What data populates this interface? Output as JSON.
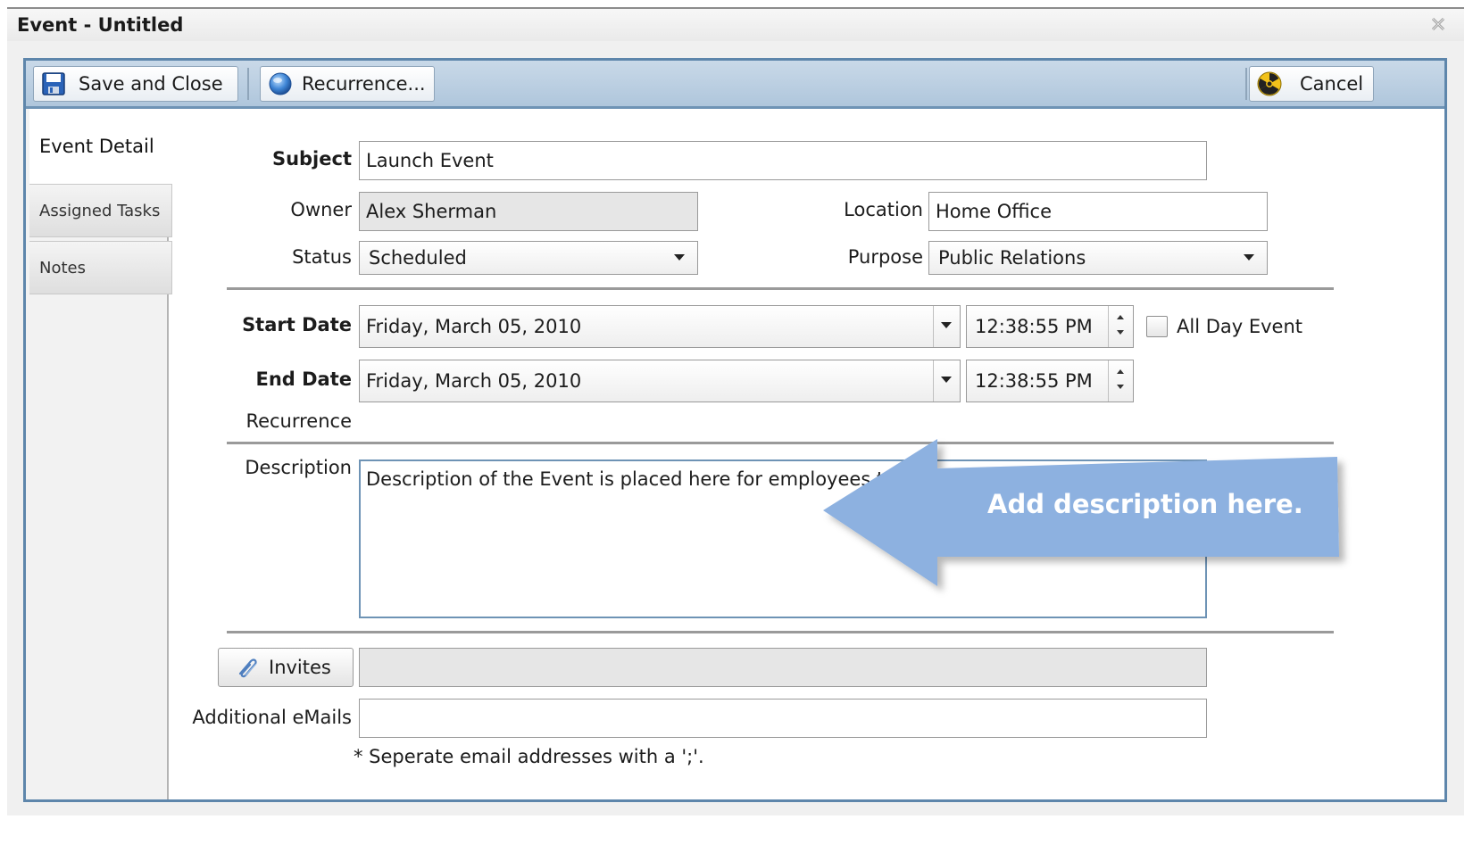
{
  "window": {
    "title": "Event - Untitled"
  },
  "toolbar": {
    "save_label": "Save and Close",
    "recurrence_label": "Recurrence...",
    "cancel_label": "Cancel"
  },
  "sidebar": {
    "tabs": [
      {
        "label": "Event Detail",
        "active": true
      },
      {
        "label": "Assigned Tasks",
        "active": false
      },
      {
        "label": "Notes",
        "active": false
      }
    ]
  },
  "form": {
    "subject_label": "Subject",
    "subject_value": "Launch Event",
    "owner_label": "Owner",
    "owner_value": "Alex Sherman",
    "location_label": "Location",
    "location_value": "Home Office",
    "status_label": "Status",
    "status_value": "Scheduled",
    "purpose_label": "Purpose",
    "purpose_value": "Public Relations",
    "start_date_label": "Start Date",
    "start_date_value": "Friday, March 05, 2010",
    "start_time_value": "12:38:55 PM",
    "all_day_label": "All Day Event",
    "all_day_checked": false,
    "end_date_label": "End Date",
    "end_date_value": "Friday, March 05, 2010",
    "end_time_value": "12:38:55 PM",
    "recurrence_label": "Recurrence",
    "description_label": "Description",
    "description_value": "Description of the Event is placed here for employees t",
    "invites_label": "Invites",
    "invites_value": "",
    "additional_emails_label": "Additional eMails",
    "additional_emails_value": "",
    "email_note": "* Seperate email addresses with a ';'."
  },
  "callout": {
    "text": "Add description here.",
    "color": "#8db1e0"
  },
  "icons": {
    "save": "floppy-disk-icon",
    "recurrence": "globe-icon",
    "cancel": "radiation-icon",
    "invites": "paperclip-icon",
    "close": "close-icon"
  }
}
